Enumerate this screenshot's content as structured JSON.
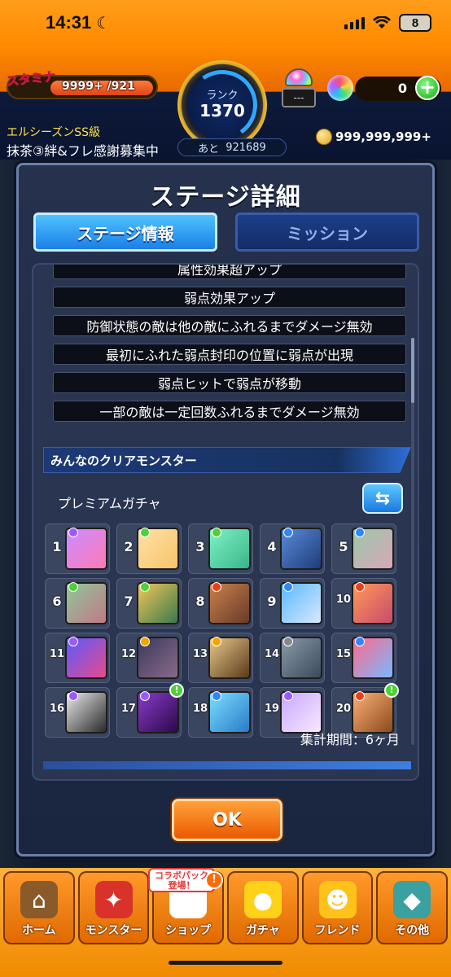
{
  "status": {
    "time": "14:31",
    "battery": "8"
  },
  "header": {
    "stamina_label": "スタミナ",
    "stamina_value": "9999+ /921",
    "rank_label": "ランク",
    "rank_value": "1370",
    "next_rank_label": "あと",
    "next_rank_value": "921689",
    "orb_machine_slot": "---",
    "orb_count": "0",
    "guild_name": "エルシーズンSS級",
    "guild_message": "抹茶③絆&フレ感謝募集中",
    "coins": "999,999,999+"
  },
  "dialog": {
    "title": "ステージ詳細",
    "tabs": [
      "ステージ情報",
      "ミッション"
    ],
    "effects": [
      "属性効果超アップ",
      "弱点効果アップ",
      "防御状態の敵は他の敵にふれるまでダメージ無効",
      "最初にふれた弱点封印の位置に弱点が出現",
      "弱点ヒットで弱点が移動",
      "一部の敵は一定回数ふれるまでダメージ無効"
    ],
    "section_title": "みんなのクリアモンスター",
    "gacha_label": "プレミアムガチャ",
    "swap_icon": "⇆",
    "period": "集計期間：6ヶ月",
    "ok_label": "OK",
    "monsters": [
      {
        "rank": "1",
        "badge": "#9b59ff",
        "colors": [
          "#c98cff",
          "#ff7ab8"
        ],
        "alert": false
      },
      {
        "rank": "2",
        "badge": "#4cd137",
        "colors": [
          "#ffe1a8",
          "#f7c46a"
        ],
        "alert": false
      },
      {
        "rank": "3",
        "badge": "#4cd137",
        "colors": [
          "#7ff2c2",
          "#38b58c"
        ],
        "alert": false
      },
      {
        "rank": "4",
        "badge": "#2e86ff",
        "colors": [
          "#5a8ad8",
          "#1e3d7a"
        ],
        "alert": false
      },
      {
        "rank": "5",
        "badge": "#2e86ff",
        "colors": [
          "#9bc6a8",
          "#d8a8b8"
        ],
        "alert": false
      },
      {
        "rank": "6",
        "badge": "#4cd137",
        "colors": [
          "#8fc89a",
          "#c07888"
        ],
        "alert": false
      },
      {
        "rank": "7",
        "badge": "#4cd137",
        "colors": [
          "#f2c65a",
          "#3a7a4a"
        ],
        "alert": false
      },
      {
        "rank": "8",
        "badge": "#e84118",
        "colors": [
          "#c8824a",
          "#6a3a2a"
        ],
        "alert": false
      },
      {
        "rank": "9",
        "badge": "#2e86ff",
        "colors": [
          "#5ab8ff",
          "#d8e8ff"
        ],
        "alert": false
      },
      {
        "rank": "10",
        "badge": "#e84118",
        "colors": [
          "#ff9a5a",
          "#c84a6a"
        ],
        "alert": false
      },
      {
        "rank": "11",
        "badge": "#9b59ff",
        "colors": [
          "#5a5aff",
          "#e84a8a"
        ],
        "alert": false
      },
      {
        "rank": "12",
        "badge": "#f0a500",
        "colors": [
          "#3a3a5a",
          "#8a6a8a"
        ],
        "alert": false
      },
      {
        "rank": "13",
        "badge": "#f0a500",
        "colors": [
          "#e8c88a",
          "#5a3a1a"
        ],
        "alert": false
      },
      {
        "rank": "14",
        "badge": "#888888",
        "colors": [
          "#8a9aaa",
          "#3a4a5a"
        ],
        "alert": false
      },
      {
        "rank": "15",
        "badge": "#2e86ff",
        "colors": [
          "#ff6a8a",
          "#7ab8ff"
        ],
        "alert": false
      },
      {
        "rank": "16",
        "badge": "#9b59ff",
        "colors": [
          "#eaeaea",
          "#2a2a2a"
        ],
        "alert": false
      },
      {
        "rank": "17",
        "badge": "#9b59ff",
        "colors": [
          "#8a3ac8",
          "#2a0a4a"
        ],
        "alert": true
      },
      {
        "rank": "18",
        "badge": "#2e86ff",
        "colors": [
          "#7ae0ff",
          "#2a7ac8"
        ],
        "alert": false
      },
      {
        "rank": "19",
        "badge": "#9b59ff",
        "colors": [
          "#c8a8ff",
          "#f8e8ff"
        ],
        "alert": false
      },
      {
        "rank": "20",
        "badge": "#e84118",
        "colors": [
          "#ffb07a",
          "#8a4a1a"
        ],
        "alert": true
      }
    ]
  },
  "nav": {
    "items": [
      {
        "label": "ホーム",
        "icon": "home-icon",
        "glyph": "⌂",
        "bg": "#8a5a2a"
      },
      {
        "label": "モンスター",
        "icon": "monster-icon",
        "glyph": "✦",
        "bg": "#d8322a"
      },
      {
        "label": "ショップ",
        "icon": "shop-icon",
        "glyph": "◉",
        "bg": "#ffffff"
      },
      {
        "label": "ガチャ",
        "icon": "gacha-icon",
        "glyph": "●",
        "bg": "#ffd21a"
      },
      {
        "label": "フレンド",
        "icon": "friend-icon",
        "glyph": "☻",
        "bg": "#ffc21a"
      },
      {
        "label": "その他",
        "icon": "other-icon",
        "glyph": "◆",
        "bg": "#3aa0a0"
      }
    ],
    "shop_tag": "コラボパック\n登場！",
    "shop_alert": "!"
  }
}
